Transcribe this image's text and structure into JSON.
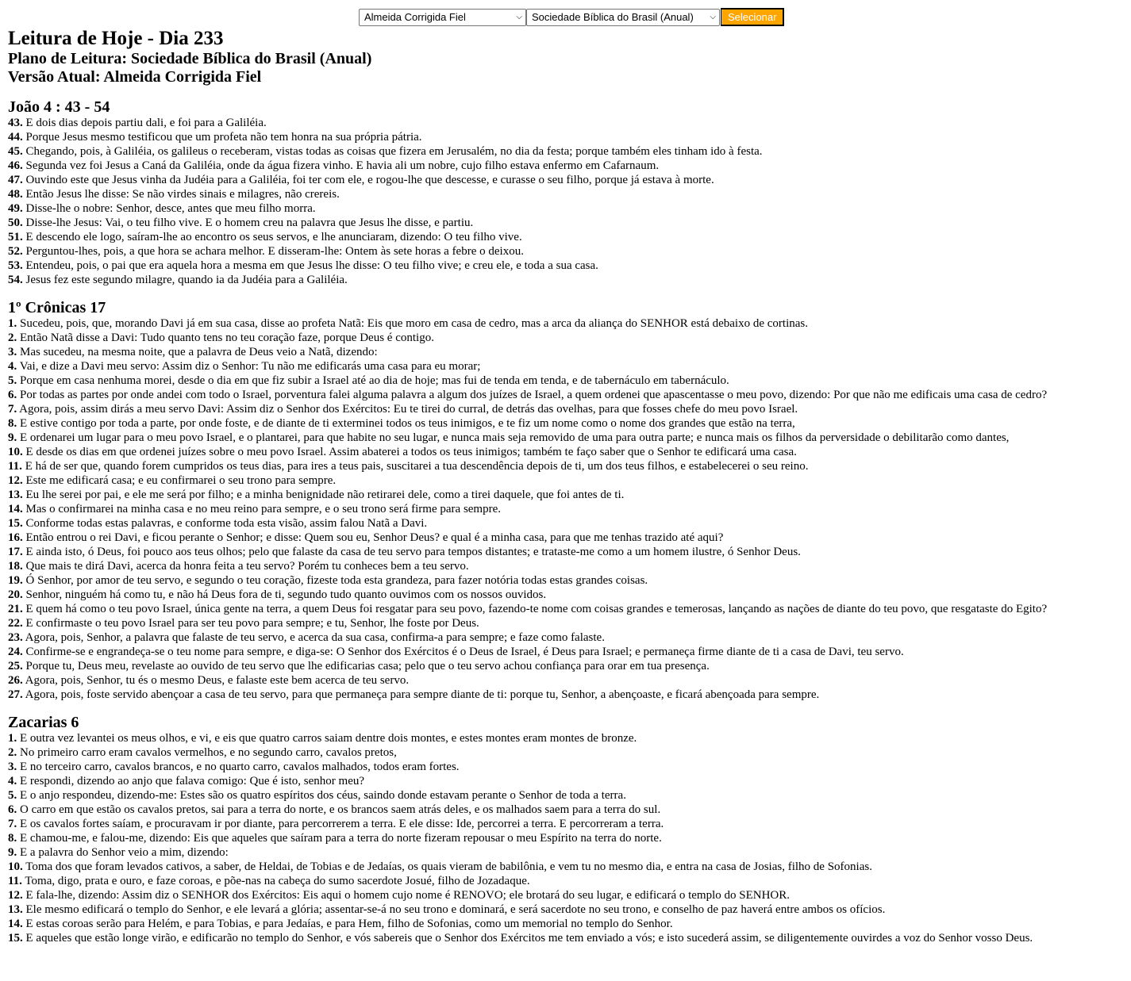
{
  "controls": {
    "version_selected": "Almeida Corrigida Fiel",
    "plan_selected": "Sociedade Bíblica do Brasil (Anual)",
    "submit_label": "Selecionar",
    "accent_color": "#ffa500"
  },
  "header": {
    "title": "Leitura de Hoje - Dia 233",
    "plan": "Plano de Leitura: Sociedade Bíblica do Brasil (Anual)",
    "version": "Versão Atual: Almeida Corrigida Fiel"
  },
  "readings": [
    {
      "title": "João 4 : 43 - 54",
      "verses": [
        {
          "n": "43.",
          "t": " E dois dias depois partiu dali, e foi para a Galiléia."
        },
        {
          "n": "44.",
          "t": " Porque Jesus mesmo testificou que um profeta não tem honra na sua própria pátria."
        },
        {
          "n": "45.",
          "t": " Chegando, pois, à Galiléia, os galileus o receberam, vistas todas as coisas que fizera em Jerusalém, no dia da festa; porque também eles tinham ido à festa."
        },
        {
          "n": "46.",
          "t": " Segunda vez foi Jesus a Caná da Galiléia, onde da água fizera vinho. E havia ali um nobre, cujo filho estava enfermo em Cafarnaum."
        },
        {
          "n": "47.",
          "t": " Ouvindo este que Jesus vinha da Judéia para a Galiléia, foi ter com ele, e rogou-lhe que descesse, e curasse o seu filho, porque já estava à morte."
        },
        {
          "n": "48.",
          "t": " Então Jesus lhe disse: Se não virdes sinais e milagres, não crereis."
        },
        {
          "n": "49.",
          "t": " Disse-lhe o nobre: Senhor, desce, antes que meu filho morra."
        },
        {
          "n": "50.",
          "t": " Disse-lhe Jesus: Vai, o teu filho vive. E o homem creu na palavra que Jesus lhe disse, e partiu."
        },
        {
          "n": "51.",
          "t": " E descendo ele logo, saíram-lhe ao encontro os seus servos, e lhe anunciaram, dizendo: O teu filho vive."
        },
        {
          "n": "52.",
          "t": " Perguntou-lhes, pois, a que hora se achara melhor. E disseram-lhe: Ontem às sete horas a febre o deixou."
        },
        {
          "n": "53.",
          "t": " Entendeu, pois, o pai que era aquela hora a mesma em que Jesus lhe disse: O teu filho vive; e creu ele, e toda a sua casa."
        },
        {
          "n": "54.",
          "t": " Jesus fez este segundo milagre, quando ia da Judéia para a Galiléia."
        }
      ]
    },
    {
      "title": "1º Crônicas 17",
      "verses": [
        {
          "n": "1.",
          "t": " Sucedeu, pois, que, morando Davi já em sua casa, disse ao profeta Natã: Eis que moro em casa de cedro, mas a arca da aliança do SENHOR está debaixo de cortinas."
        },
        {
          "n": "2.",
          "t": " Então Natã disse a Davi: Tudo quanto tens no teu coração faze, porque Deus é contigo."
        },
        {
          "n": "3.",
          "t": " Mas sucedeu, na mesma noite, que a palavra de Deus veio a Natã, dizendo:"
        },
        {
          "n": "4.",
          "t": " Vai, e dize a Davi meu servo: Assim diz o Senhor: Tu não me edificarás uma casa para eu morar;"
        },
        {
          "n": "5.",
          "t": " Porque em casa nenhuma morei, desde o dia em que fiz subir a Israel até ao dia de hoje; mas fui de tenda em tenda, e de tabernáculo em tabernáculo."
        },
        {
          "n": "6.",
          "t": " Por todas as partes por onde andei com todo o Israel, porventura falei alguma palavra a algum dos juízes de Israel, a quem ordenei que apascentasse o meu povo, dizendo: Por que não me edificais uma casa de cedro?"
        },
        {
          "n": "7.",
          "t": " Agora, pois, assim dirás a meu servo Davi: Assim diz o Senhor dos Exércitos: Eu te tirei do curral, de detrás das ovelhas, para que fosses chefe do meu povo Israel."
        },
        {
          "n": "8.",
          "t": " E estive contigo por toda a parte, por onde foste, e de diante de ti exterminei todos os teus inimigos, e te fiz um nome como o nome dos grandes que estão na terra,"
        },
        {
          "n": "9.",
          "t": " E ordenarei um lugar para o meu povo Israel, e o plantarei, para que habite no seu lugar, e nunca mais seja removido de uma para outra parte; e nunca mais os filhos da perversidade o debilitarão como dantes,"
        },
        {
          "n": "10.",
          "t": " E desde os dias em que ordenei juízes sobre o meu povo Israel. Assim abaterei a todos os teus inimigos; também te faço saber que o Senhor te edificará uma casa."
        },
        {
          "n": "11.",
          "t": " E há de ser que, quando forem cumpridos os teus dias, para ires a teus pais, suscitarei a tua descendência depois de ti, um dos teus filhos, e estabelecerei o seu reino."
        },
        {
          "n": "12.",
          "t": " Este me edificará casa; e eu confirmarei o seu trono para sempre."
        },
        {
          "n": "13.",
          "t": " Eu lhe serei por pai, e ele me será por filho; e a minha benignidade não retirarei dele, como a tirei daquele, que foi antes de ti."
        },
        {
          "n": "14.",
          "t": " Mas o confirmarei na minha casa e no meu reino para sempre, e o seu trono será firme para sempre."
        },
        {
          "n": "15.",
          "t": " Conforme todas estas palavras, e conforme toda esta visão, assim falou Natã a Davi."
        },
        {
          "n": "16.",
          "t": " Então entrou o rei Davi, e ficou perante o Senhor; e disse: Quem sou eu, Senhor Deus? e qual é a minha casa, para que me tenhas trazido até aqui?"
        },
        {
          "n": "17.",
          "t": " E ainda isto, ó Deus, foi pouco aos teus olhos; pelo que falaste da casa de teu servo para tempos distantes; e trataste-me como a um homem ilustre, ó Senhor Deus."
        },
        {
          "n": "18.",
          "t": " Que mais te dirá Davi, acerca da honra feita a teu servo? Porém tu conheces bem a teu servo."
        },
        {
          "n": "19.",
          "t": " Ó Senhor, por amor de teu servo, e segundo o teu coração, fizeste toda esta grandeza, para fazer notória todas estas grandes coisas."
        },
        {
          "n": "20.",
          "t": " Senhor, ninguém há como tu, e não há Deus fora de ti, segundo tudo quanto ouvimos com os nossos ouvidos."
        },
        {
          "n": "21.",
          "t": " E quem há como o teu povo Israel, única gente na terra, a quem Deus foi resgatar para seu povo, fazendo-te nome com coisas grandes e temerosas, lançando as nações de diante do teu povo, que resgataste do Egito?"
        },
        {
          "n": "22.",
          "t": " E confirmaste o teu povo Israel para ser teu povo para sempre; e tu, Senhor, lhe foste por Deus."
        },
        {
          "n": "23.",
          "t": " Agora, pois, Senhor, a palavra que falaste de teu servo, e acerca da sua casa, confirma-a para sempre; e faze como falaste."
        },
        {
          "n": "24.",
          "t": " Confirme-se e engrandeça-se o teu nome para sempre, e diga-se: O Senhor dos Exércitos é o Deus de Israel, é Deus para Israel; e permaneça firme diante de ti a casa de Davi, teu servo."
        },
        {
          "n": "25.",
          "t": " Porque tu, Deus meu, revelaste ao ouvido de teu servo que lhe edificarias casa; pelo que o teu servo achou confiança para orar em tua presença."
        },
        {
          "n": "26.",
          "t": " Agora, pois, Senhor, tu és o mesmo Deus, e falaste este bem acerca de teu servo."
        },
        {
          "n": "27.",
          "t": " Agora, pois, foste servido abençoar a casa de teu servo, para que permaneça para sempre diante de ti: porque tu, Senhor, a abençoaste, e ficará abençoada para sempre."
        }
      ]
    },
    {
      "title": "Zacarias 6",
      "verses": [
        {
          "n": "1.",
          "t": " E outra vez levantei os meus olhos, e vi, e eis que quatro carros saiam dentre dois montes, e estes montes eram montes de bronze."
        },
        {
          "n": "2.",
          "t": " No primeiro carro eram cavalos vermelhos, e no segundo carro, cavalos pretos,"
        },
        {
          "n": "3.",
          "t": " E no terceiro carro, cavalos brancos, e no quarto carro, cavalos malhados, todos eram fortes."
        },
        {
          "n": "4.",
          "t": " E respondi, dizendo ao anjo que falava comigo: Que é isto, senhor meu?"
        },
        {
          "n": "5.",
          "t": " E o anjo respondeu, dizendo-me: Estes são os quatro espíritos dos céus, saindo donde estavam perante o Senhor de toda a terra."
        },
        {
          "n": "6.",
          "t": " O carro em que estão os cavalos pretos, sai para a terra do norte, e os brancos saem atrás deles, e os malhados saem para a terra do sul."
        },
        {
          "n": "7.",
          "t": " E os cavalos fortes saíam, e procuravam ir por diante, para percorrerem a terra. E ele disse: Ide, percorrei a terra. E percorreram a terra."
        },
        {
          "n": "8.",
          "t": " E chamou-me, e falou-me, dizendo: Eis que aqueles que saíram para a terra do norte fizeram repousar o meu Espírito na terra do norte."
        },
        {
          "n": "9.",
          "t": " E a palavra do Senhor veio a mim, dizendo:"
        },
        {
          "n": "10.",
          "t": " Toma dos que foram levados cativos, a saber, de Heldai, de Tobias e de Jedaías, os quais vieram de babilônia, e vem tu no mesmo dia, e entra na casa de Josias, filho de Sofonias."
        },
        {
          "n": "11.",
          "t": " Toma, digo, prata e ouro, e faze coroas, e põe-nas na cabeça do sumo sacerdote Josué, filho de Jozadaque."
        },
        {
          "n": "12.",
          "t": " E fala-lhe, dizendo: Assim diz o SENHOR dos Exércitos: Eis aqui o homem cujo nome é RENOVO; ele brotará do seu lugar, e edificará o templo do SENHOR."
        },
        {
          "n": "13.",
          "t": " Ele mesmo edificará o templo do Senhor, e ele levará a glória; assentar-se-á no seu trono e dominará, e será sacerdote no seu trono, e conselho de paz haverá entre ambos os ofícios."
        },
        {
          "n": "14.",
          "t": " E estas coroas serão para Helém, e para Tobias, e para Jedaías, e para Hem, filho de Sofonias, como um memorial no templo do Senhor."
        },
        {
          "n": "15.",
          "t": " E aqueles que estão longe virão, e edificarão no templo do Senhor, e vós sabereis que o Senhor dos Exércitos me tem enviado a vós; e isto sucederá assim, se diligentemente ouvirdes a voz do Senhor vosso Deus."
        }
      ]
    }
  ]
}
